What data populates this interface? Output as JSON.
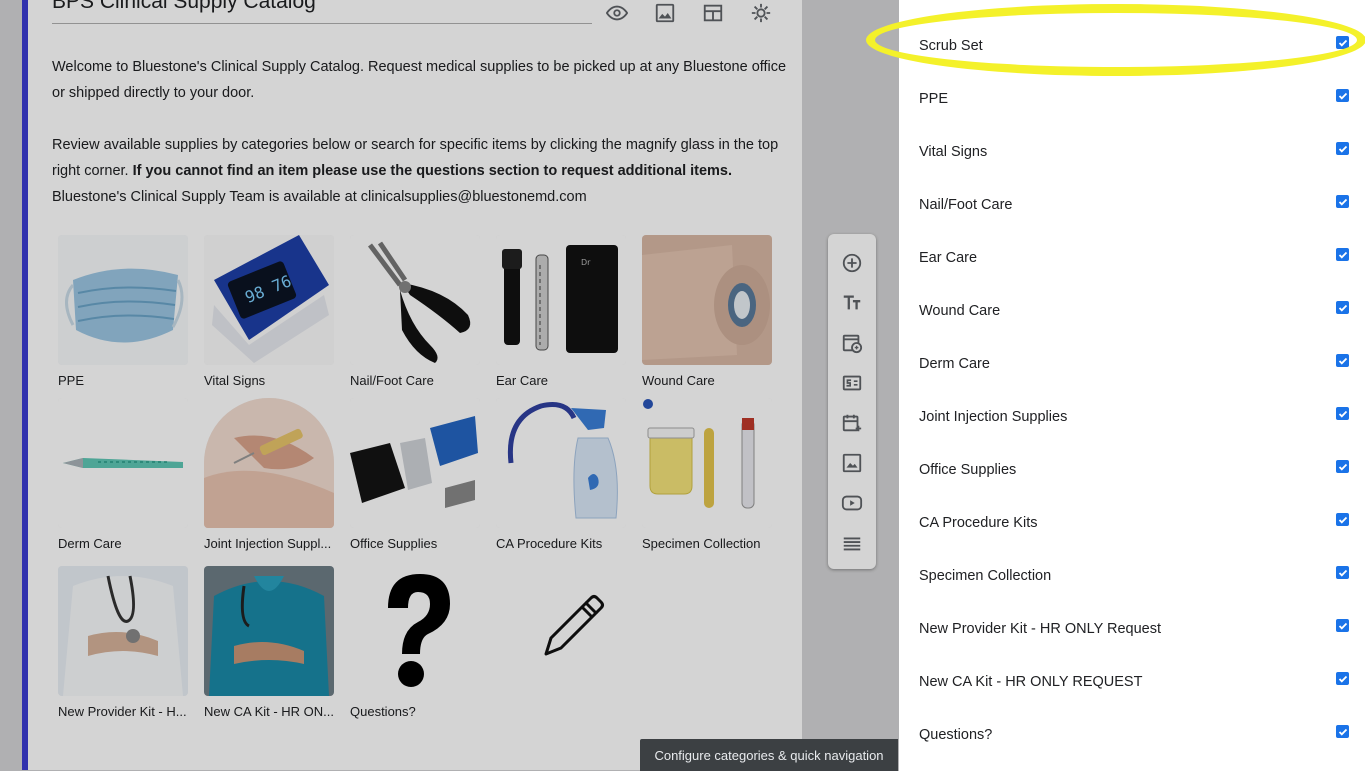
{
  "form": {
    "title": "BPS Clinical Supply Catalog",
    "description_1": "Welcome to Bluestone's Clinical Supply Catalog. Request medical supplies to be picked up at any Bluestone office or shipped directly to your door.",
    "description_2_plain": "Review available supplies by categories below or search for specific items by clicking the magnify glass in the top right corner. ",
    "description_2_bold": "If you cannot find an item please use the questions section to request additional items.",
    "description_3": "Bluestone's Clinical Supply Team is available at clinicalsupplies@bluestonemd.com",
    "header_icons": [
      "eye-icon",
      "image-icon",
      "layout-icon",
      "gear-icon"
    ]
  },
  "tiles": [
    {
      "label": "PPE",
      "icon": "face-mask-image"
    },
    {
      "label": "Vital Signs",
      "icon": "pulse-oximeter-image"
    },
    {
      "label": "Nail/Foot Care",
      "icon": "nail-clipper-image"
    },
    {
      "label": "Ear Care",
      "icon": "otoscope-image"
    },
    {
      "label": "Wound Care",
      "icon": "bandage-roll-image"
    },
    {
      "label": "Derm Care",
      "icon": "scalpel-image"
    },
    {
      "label": "Joint Injection Suppl...",
      "icon": "injection-image"
    },
    {
      "label": "Office Supplies",
      "icon": "stapler-image"
    },
    {
      "label": "CA Procedure Kits",
      "icon": "spray-bottle-image"
    },
    {
      "label": "Specimen Collection",
      "icon": "specimen-cup-image"
    },
    {
      "label": "New Provider Kit - H...",
      "icon": "doctor-image"
    },
    {
      "label": "New CA Kit - HR ON...",
      "icon": "nurse-image"
    },
    {
      "label": "Questions?",
      "icon": "question-mark-image"
    },
    {
      "label": "",
      "icon": "pencil-edit-icon"
    }
  ],
  "toolbar": [
    "add-question-icon",
    "text-title-icon",
    "import-questions-icon",
    "section-icon",
    "add-date-icon",
    "add-image-icon",
    "add-video-icon",
    "add-section-icon"
  ],
  "panel": {
    "items": [
      {
        "label": "Scrub Set",
        "checked": true
      },
      {
        "label": "PPE",
        "checked": true
      },
      {
        "label": "Vital Signs",
        "checked": true
      },
      {
        "label": "Nail/Foot Care",
        "checked": true
      },
      {
        "label": "Ear Care",
        "checked": true
      },
      {
        "label": "Wound Care",
        "checked": true
      },
      {
        "label": "Derm Care",
        "checked": true
      },
      {
        "label": "Joint Injection Supplies",
        "checked": true
      },
      {
        "label": "Office Supplies",
        "checked": true
      },
      {
        "label": "CA Procedure Kits",
        "checked": true
      },
      {
        "label": "Specimen Collection",
        "checked": true
      },
      {
        "label": "New Provider Kit - HR ONLY Request",
        "checked": true
      },
      {
        "label": "New CA Kit - HR ONLY REQUEST",
        "checked": true
      },
      {
        "label": "Questions?",
        "checked": true
      }
    ]
  },
  "tooltip": "Configure categories & quick navigation",
  "colors": {
    "accent": "#3b3bd0",
    "checkbox": "#1a73e8",
    "highlight": "#f4f12a"
  }
}
